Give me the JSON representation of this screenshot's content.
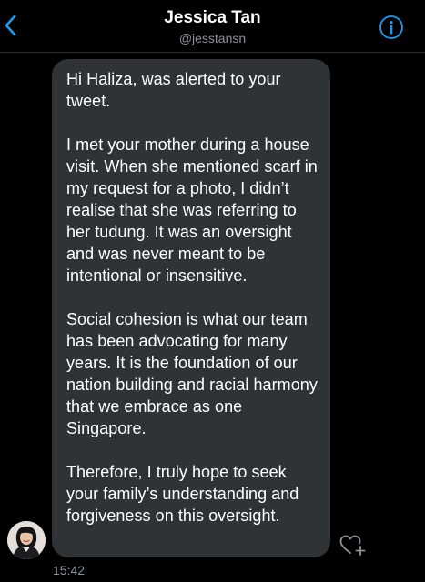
{
  "header": {
    "contact_name": "Jessica Tan",
    "contact_handle": "@jesstansn",
    "back_icon": "chevron-left-icon",
    "info_icon": "info-circle-icon",
    "accent_color": "#1d9bf0"
  },
  "conversation": {
    "message": {
      "paragraphs": [
        "Hi Haliza, was alerted to your tweet.",
        "I met your mother during a house visit. When she mentioned scarf in my request for a photo, I didn’t realise that she was referring to her tudung. It was an oversight and was never meant to be intentional or insensitive.",
        "Social cohesion is what our team has been advocating for many years. It is the foundation of our nation building and racial harmony that we embrace as one Singapore.",
        "Therefore, I truly hope to seek your family’s understanding and forgiveness on this oversight."
      ],
      "timestamp": "15:42",
      "react_icon": "heart-plus-icon",
      "bubble_color": "#2f3336"
    },
    "sender_avatar": "avatar"
  }
}
